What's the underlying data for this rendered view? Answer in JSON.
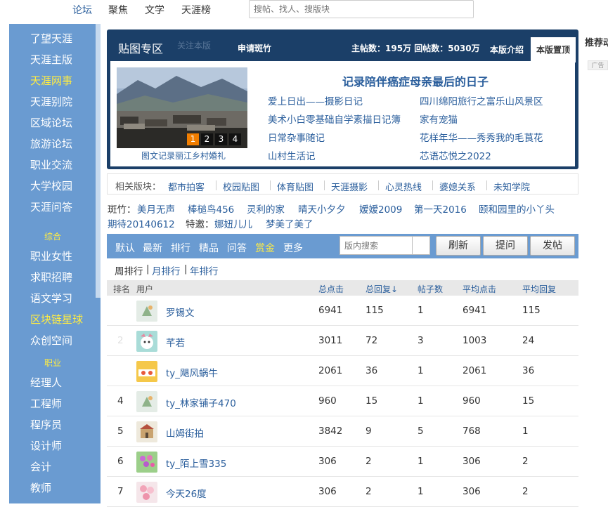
{
  "topnav": {
    "items": [
      "论坛",
      "聚焦",
      "文学",
      "天涯榜"
    ],
    "search_placeholder": "搜帖、找人、搜版块"
  },
  "sidebar": {
    "items": [
      "了望天涯",
      "天涯主版",
      "天涯网事",
      "天涯别院",
      "区域论坛",
      "旅游论坛",
      "职业交流",
      "大学校园",
      "天涯问答"
    ],
    "section1": "综合",
    "items2": [
      "职业女性",
      "求职招聘",
      "语文学习",
      "区块链星球",
      "众创空间"
    ],
    "section2": "职业",
    "items3": [
      "经理人",
      "工程师",
      "程序员",
      "设计师",
      "会计",
      "教师"
    ]
  },
  "banner": {
    "title": "贴图专区",
    "follow": "关注本版",
    "apply_mod": "申请斑竹",
    "stats": "主帖数：195万 回帖数：5030万",
    "intro": "本版介绍",
    "home": "本版置顶",
    "photo_caption": "图文记录丽江乡村婚礼",
    "pages": [
      "1",
      "2",
      "3",
      "4"
    ],
    "featured": "记录陪伴癌症母亲最后的日子",
    "links": [
      "爱上日出——摄影日记",
      "四川绵阳旅行之富乐山风景区",
      "美术小白零基础自学素描日记簿",
      "家有宠猫",
      "日常杂事随记",
      "花样年华——秀秀我的毛莨花",
      "山村生活记",
      "芯语芯悦之2022"
    ]
  },
  "related": {
    "label": "相关版块：",
    "boards": [
      "都市拍客",
      "校园贴图",
      "体育贴图",
      "天涯摄影",
      "心灵热线",
      "婆媳关系",
      "未知学院"
    ]
  },
  "moderators": {
    "label": "斑竹：",
    "names": [
      "美月无声",
      "棒槌鸟456",
      "灵利的家",
      "晴天小夕夕",
      "嫒嫒2009",
      "第一天2016",
      "颐和园里的小丫头",
      "期待20140612"
    ],
    "guest_label": "特邀：",
    "guests": [
      "娜妞儿儿",
      "梦美了美了"
    ]
  },
  "toolbar": {
    "tabs": [
      "默认",
      "最新",
      "排行",
      "精品",
      "问答",
      "赏金",
      "更多"
    ],
    "search_placeholder": "版内搜索",
    "refresh": "刷新",
    "ask": "提问",
    "post": "发帖"
  },
  "ranking_tabs": [
    "周排行",
    "月排行",
    "年排行"
  ],
  "table": {
    "headers": [
      "排名",
      "用户",
      "总点击",
      "总回复↓",
      "帖子数",
      "平均点击",
      "平均回复"
    ],
    "rows": [
      {
        "rank": "",
        "user": "罗锡文",
        "clicks": "6941",
        "replies": "115",
        "posts": "1",
        "avg_clicks": "6941",
        "avg_replies": "115"
      },
      {
        "rank": "2",
        "user": "芊若",
        "clicks": "3011",
        "replies": "72",
        "posts": "3",
        "avg_clicks": "1003",
        "avg_replies": "24"
      },
      {
        "rank": "",
        "user": "ty_飓风蜗牛",
        "clicks": "2061",
        "replies": "36",
        "posts": "1",
        "avg_clicks": "2061",
        "avg_replies": "36"
      },
      {
        "rank": "4",
        "user": "ty_林家铺子470",
        "clicks": "960",
        "replies": "15",
        "posts": "1",
        "avg_clicks": "960",
        "avg_replies": "15"
      },
      {
        "rank": "5",
        "user": "山姆街拍",
        "clicks": "3842",
        "replies": "9",
        "posts": "5",
        "avg_clicks": "768",
        "avg_replies": "1"
      },
      {
        "rank": "6",
        "user": "ty_陌上雪335",
        "clicks": "306",
        "replies": "2",
        "posts": "1",
        "avg_clicks": "306",
        "avg_replies": "2"
      },
      {
        "rank": "7",
        "user": "今天26度",
        "clicks": "306",
        "replies": "2",
        "posts": "1",
        "avg_clicks": "306",
        "avg_replies": "2"
      }
    ]
  },
  "right": {
    "title": "推荐动",
    "ad": "广告"
  },
  "colors": {
    "sidebar": "#6a9bd1",
    "banner": "#1b3f68",
    "link": "#2a5e9c",
    "highlight": "#ffec42",
    "page_active": "#f07d00"
  }
}
